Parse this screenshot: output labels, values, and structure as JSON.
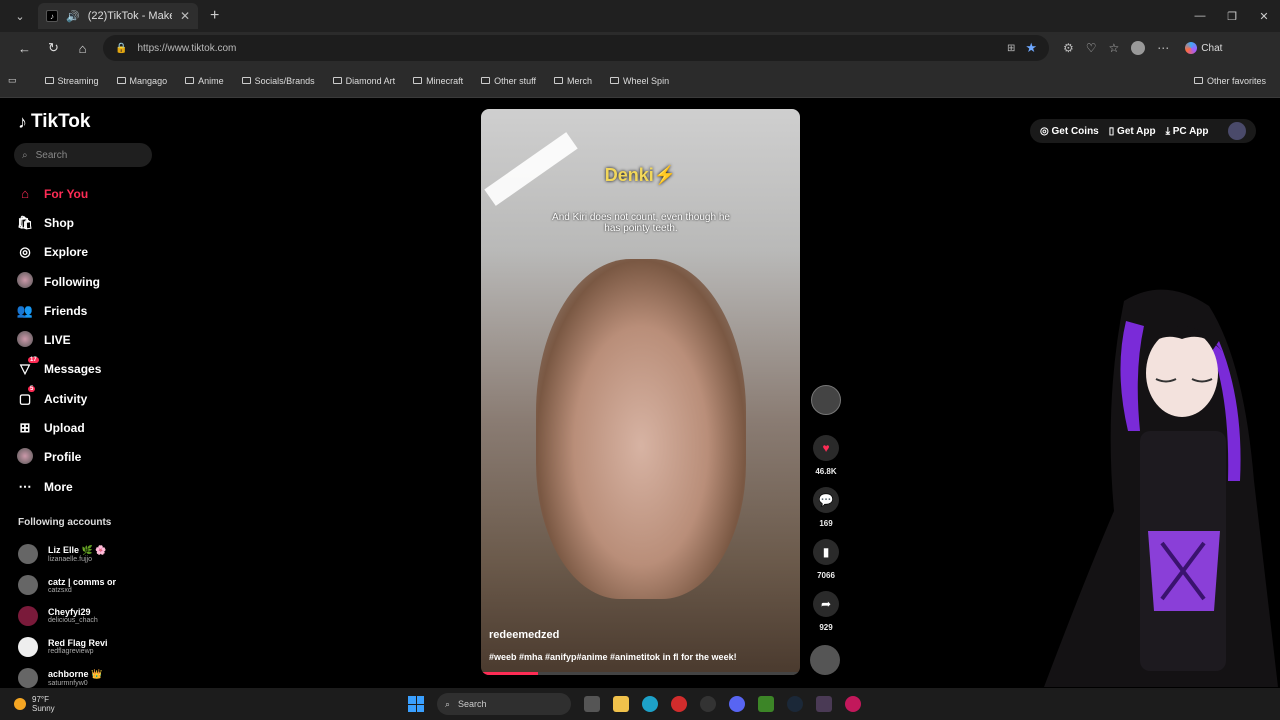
{
  "browser": {
    "tab_title": "(22)TikTok - Make",
    "url": "https://www.tiktok.com",
    "chat_label": "Chat",
    "bookmarks": [
      "Streaming",
      "Mangago",
      "Anime",
      "Socials/Brands",
      "Diamond Art",
      "Minecraft",
      "Other stuff",
      "Merch",
      "Wheel Spin"
    ],
    "other_favorites": "Other favorites"
  },
  "tiktok": {
    "logo": "TikTok",
    "search_placeholder": "Search",
    "nav": [
      {
        "label": "For You",
        "icon": "home-icon"
      },
      {
        "label": "Shop",
        "icon": "shop-icon"
      },
      {
        "label": "Explore",
        "icon": "compass-icon"
      },
      {
        "label": "Following",
        "icon": "following-icon"
      },
      {
        "label": "Friends",
        "icon": "friends-icon"
      },
      {
        "label": "LIVE",
        "icon": "live-icon"
      },
      {
        "label": "Messages",
        "icon": "messages-icon",
        "badge": "17"
      },
      {
        "label": "Activity",
        "icon": "activity-icon",
        "badge": "5"
      },
      {
        "label": "Upload",
        "icon": "upload-icon"
      },
      {
        "label": "Profile",
        "icon": "profile-icon"
      },
      {
        "label": "More",
        "icon": "more-icon"
      }
    ],
    "following_title": "Following accounts",
    "accounts": [
      {
        "name": "Liz Elle 🌿 🌸",
        "handle": "lizanaelle.fujjo"
      },
      {
        "name": "catz | comms or",
        "handle": "catzsxd"
      },
      {
        "name": "Cheyfyi29",
        "handle": "delicious_chach"
      },
      {
        "name": "Red Flag Revi",
        "handle": "redflagreviewp"
      },
      {
        "name": "achborne 👑",
        "handle": "saturmnfyw0"
      }
    ],
    "top_actions": {
      "coins": "Get Coins",
      "app": "Get App",
      "pc": "PC App"
    },
    "video": {
      "overlay_title": "Denki⚡",
      "overlay_caption": "And Kiri does not count, even though he has pointy teeth.",
      "author": "redeemedzed",
      "hashtags": "#weeb #mha #anifyp#anime #animetitok in fl for the week!",
      "progress": 0.18
    },
    "stats": {
      "likes": "46.8K",
      "comments": "169",
      "saves": "7066",
      "shares": "929"
    }
  },
  "taskbar": {
    "temp": "97°F",
    "condition": "Sunny",
    "search": "Search"
  }
}
